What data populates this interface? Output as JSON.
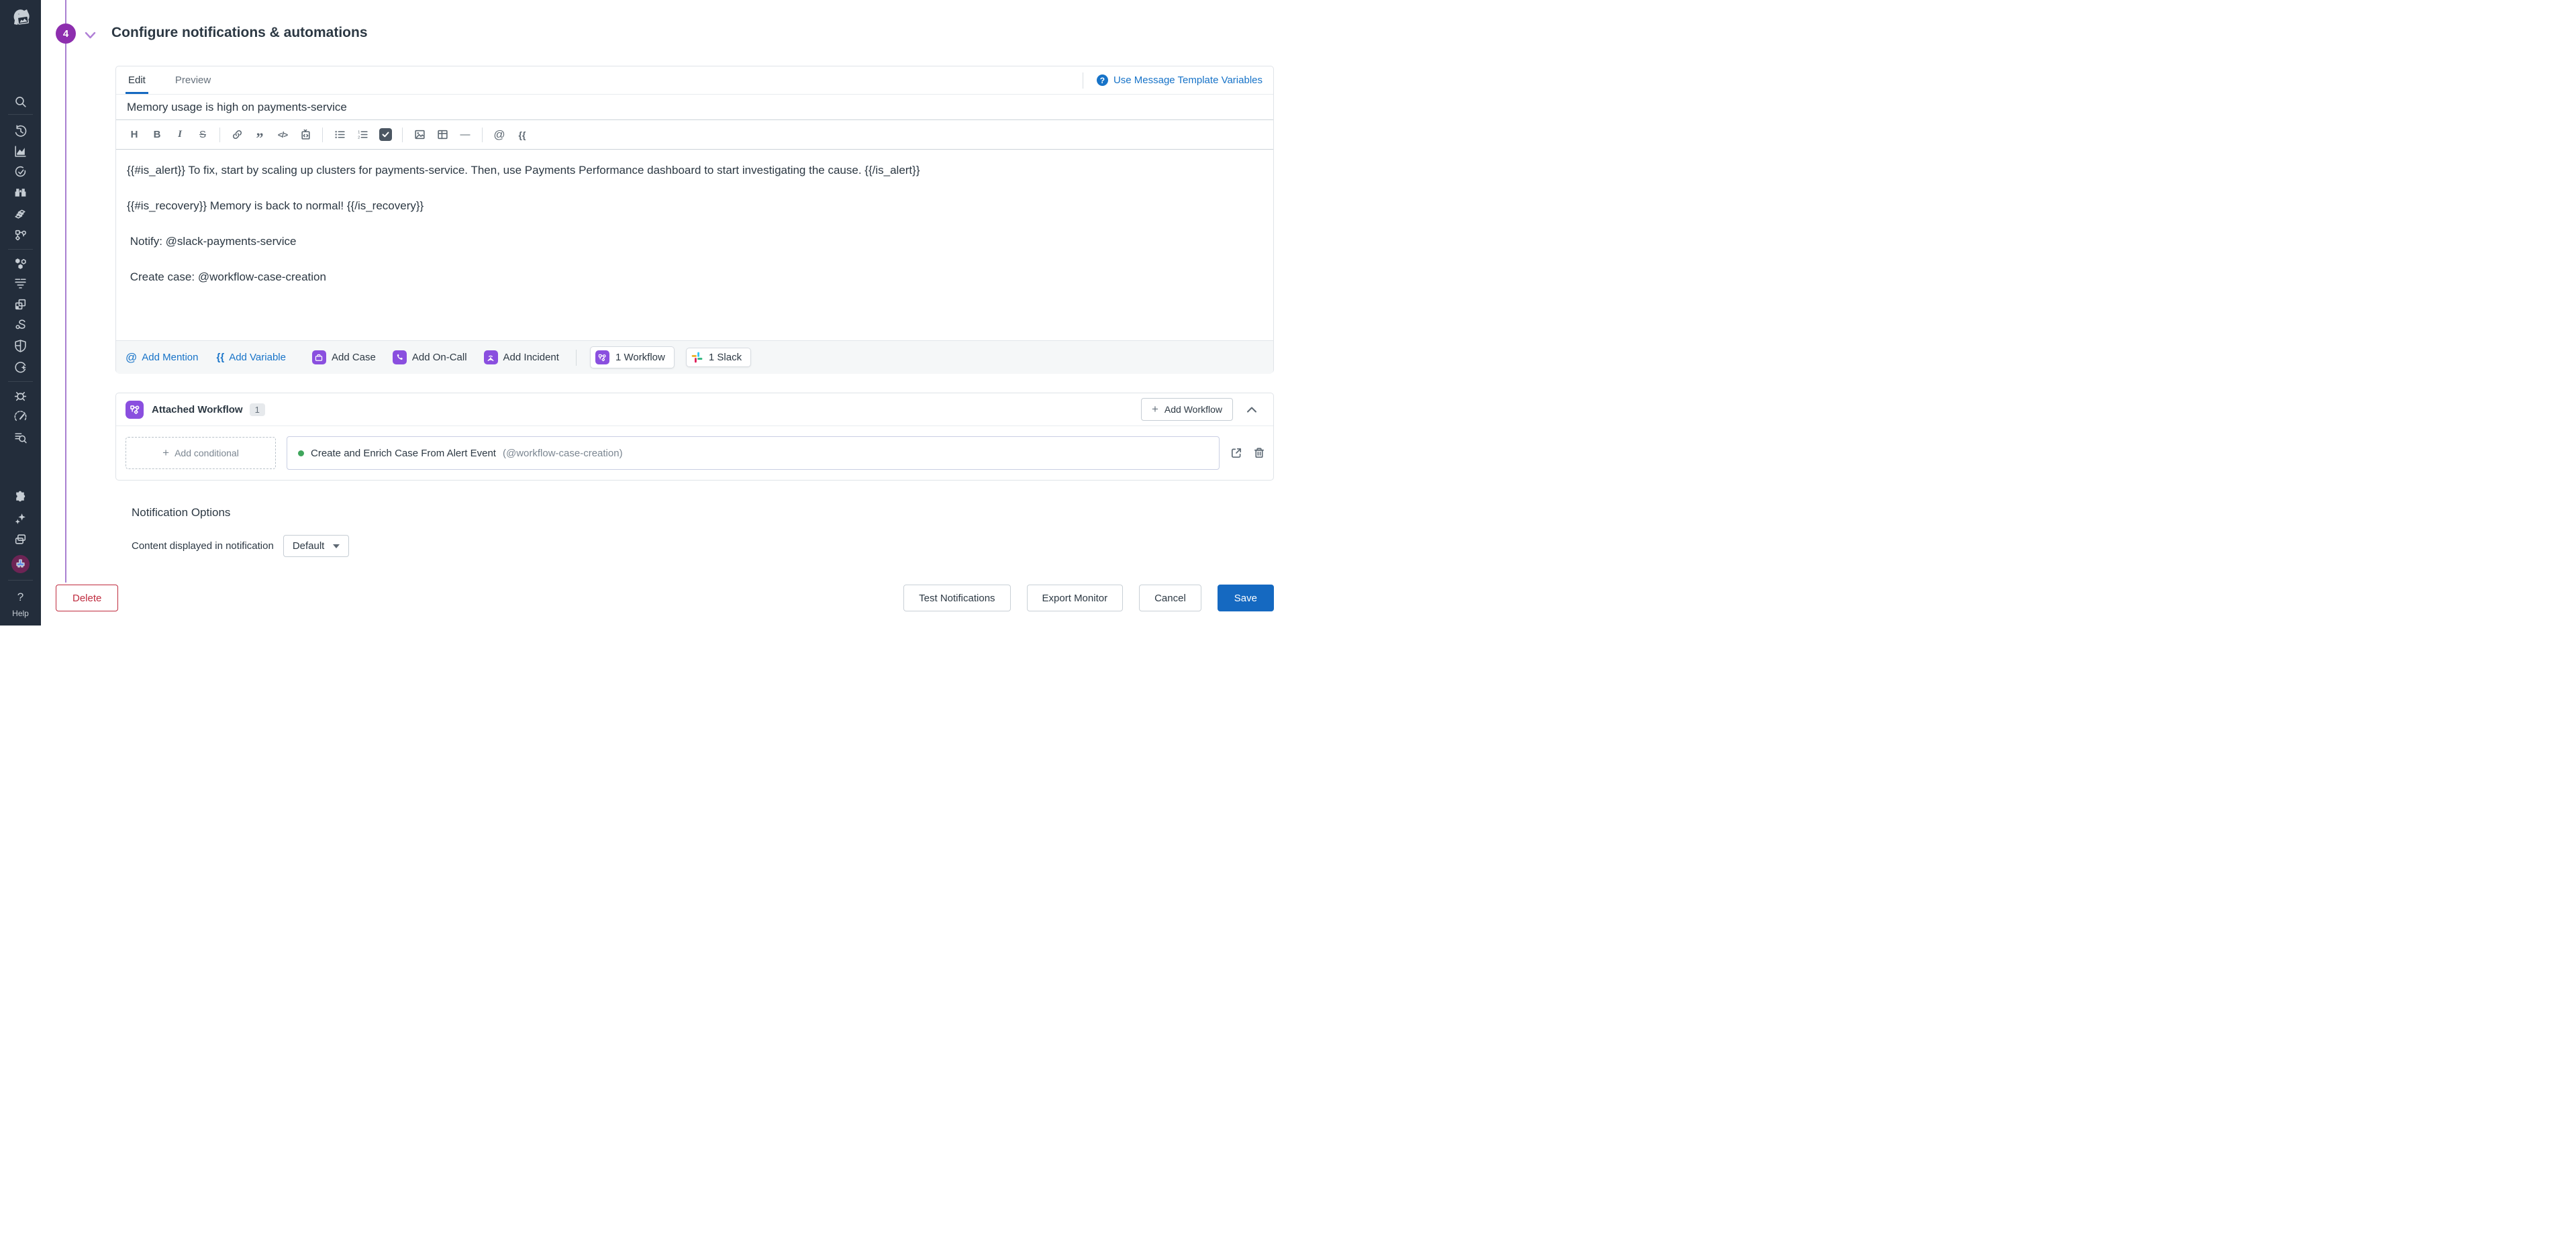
{
  "colors": {
    "sidebar_bg": "#232d3b",
    "accent_blue": "#1773c8",
    "save_blue": "#1569c1",
    "purple": "#8a4fdf",
    "step_purple": "#8d2eae",
    "delete_red": "#bf2b3e",
    "success_green": "#3fa65c",
    "slack": {
      "blue": "#36C5F0",
      "green": "#2EB67D",
      "red": "#E01E5A",
      "yellow": "#ECB22E"
    }
  },
  "sidebar": {
    "icons": [
      "datadog-logo",
      "search",
      "history",
      "metrics",
      "monitors",
      "watchdog",
      "integrations",
      "workflows",
      "infrastructure",
      "logs",
      "software-catalog",
      "ci-pipelines",
      "security",
      "llm-observability",
      "error-tracking",
      "performance",
      "log-management",
      "marketplace",
      "ai-assistant",
      "cross-org",
      "user-avatar"
    ],
    "help_icon": "?",
    "help_label": "Help"
  },
  "step": {
    "number": "4",
    "title": "Configure notifications & automations"
  },
  "editor": {
    "tabs": [
      {
        "label": "Edit"
      },
      {
        "label": "Preview"
      }
    ],
    "help_icon": "?",
    "template_variables_link": "Use Message Template Variables",
    "title_value": "Memory usage is high on payments-service",
    "toolbar_glyphs": {
      "heading": "H",
      "bold": "B",
      "italic": "I",
      "strikethrough": "S",
      "inline_code": "</>",
      "blockquote": "”",
      "horizontal_rule": "—",
      "mention": "@",
      "variable": "{{"
    },
    "body_lines": [
      "{{#is_alert}} To fix, start by scaling up clusters for payments-service. Then, use Payments Performance dashboard to start investigating the cause. {{/is_alert}}",
      "{{#is_recovery}} Memory is back to normal! {{/is_recovery}}",
      " Notify: @slack-payments-service",
      " Create case: @workflow-case-creation"
    ],
    "footer": {
      "mention_glyph": "@",
      "add_mention": "Add Mention",
      "variable_glyph": "{{",
      "add_variable": "Add Variable",
      "add_case": "Add Case",
      "add_on_call": "Add On-Call",
      "add_incident": "Add Incident",
      "workflow_chip": "1 Workflow",
      "slack_chip": "1 Slack"
    }
  },
  "attached_workflow": {
    "title": "Attached Workflow",
    "count": "1",
    "plus_glyph": "+",
    "add_workflow_button": "Add Workflow",
    "add_conditional_button": "Add conditional",
    "workflow_name": "Create and Enrich Case From Alert Event",
    "workflow_handle": "(@workflow-case-creation)"
  },
  "notification_options": {
    "heading": "Notification Options",
    "content_label": "Content displayed in notification",
    "content_value": "Default"
  },
  "actions": {
    "delete": "Delete",
    "test_notifications": "Test Notifications",
    "export_monitor": "Export Monitor",
    "cancel": "Cancel",
    "save": "Save"
  }
}
